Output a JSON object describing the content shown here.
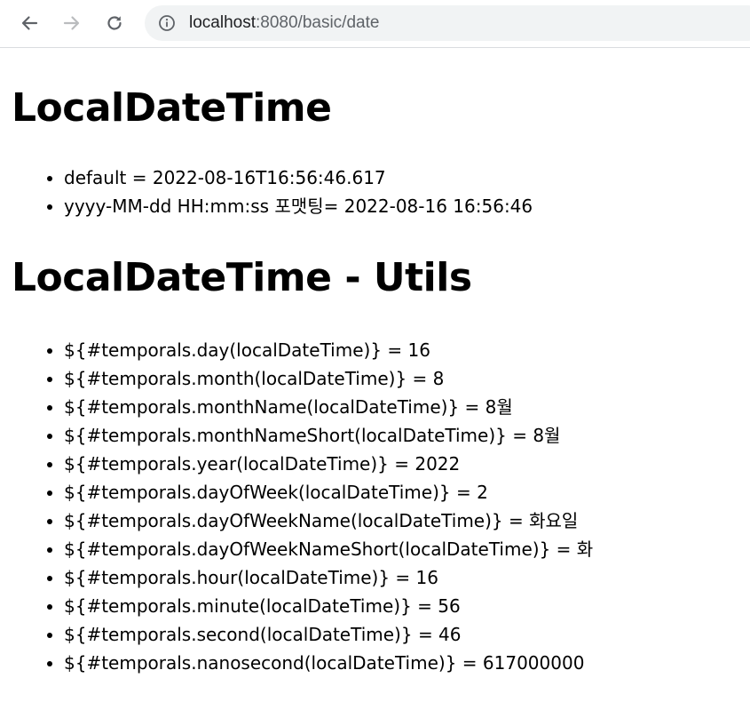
{
  "browser": {
    "url_host": "localhost",
    "url_rest": ":8080/basic/date",
    "icons": {
      "back": "arrow-left-icon",
      "forward": "arrow-right-icon",
      "reload": "reload-icon",
      "site_info": "info-icon"
    }
  },
  "page": {
    "section1": {
      "title": "LocalDateTime",
      "items": [
        "default = 2022-08-16T16:56:46.617",
        "yyyy-MM-dd HH:mm:ss 포맷팅= 2022-08-16 16:56:46"
      ]
    },
    "section2": {
      "title": "LocalDateTime - Utils",
      "items": [
        "${#temporals.day(localDateTime)} = 16",
        "${#temporals.month(localDateTime)} = 8",
        "${#temporals.monthName(localDateTime)} = 8월",
        "${#temporals.monthNameShort(localDateTime)} = 8월",
        "${#temporals.year(localDateTime)} = 2022",
        "${#temporals.dayOfWeek(localDateTime)} = 2",
        "${#temporals.dayOfWeekName(localDateTime)} = 화요일",
        "${#temporals.dayOfWeekNameShort(localDateTime)} = 화",
        "${#temporals.hour(localDateTime)} = 16",
        "${#temporals.minute(localDateTime)} = 56",
        "${#temporals.second(localDateTime)} = 46",
        "${#temporals.nanosecond(localDateTime)} = 617000000"
      ]
    }
  }
}
